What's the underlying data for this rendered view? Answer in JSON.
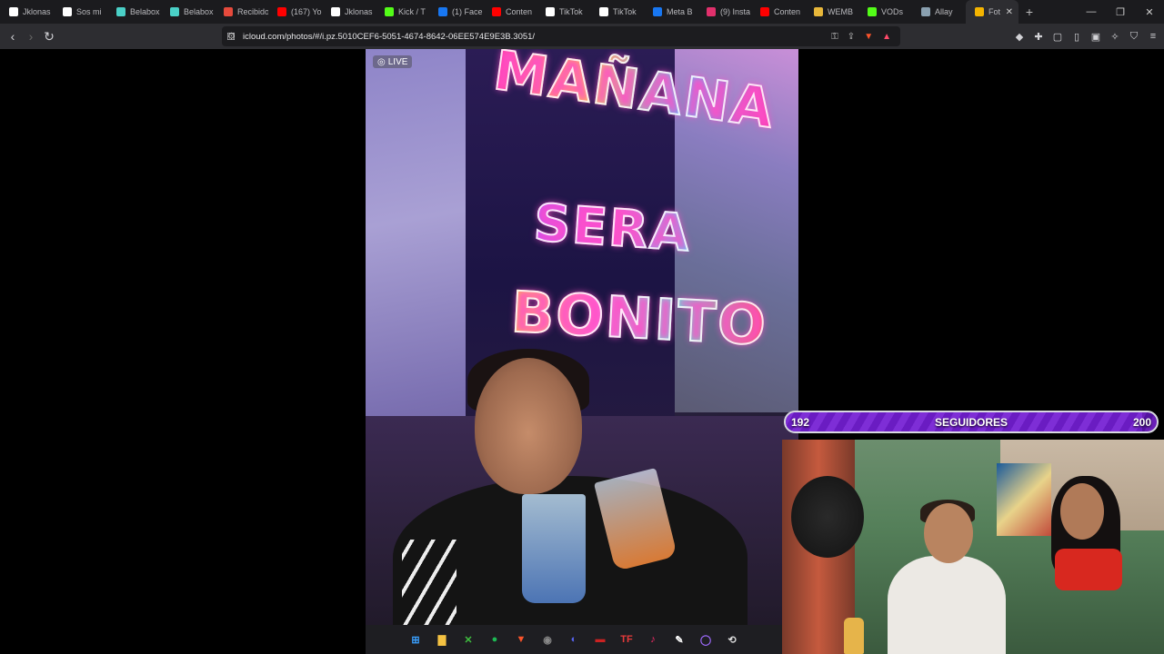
{
  "browser": {
    "tabs": [
      {
        "label": "Jklonas",
        "icon": "github-icon",
        "color": "#ffffff"
      },
      {
        "label": "Sos mi",
        "icon": "github-icon",
        "color": "#ffffff"
      },
      {
        "label": "Belabox",
        "icon": "belabox-icon",
        "color": "#4ad0c7"
      },
      {
        "label": "Belabox",
        "icon": "belabox-icon",
        "color": "#4ad0c7"
      },
      {
        "label": "Recibido",
        "icon": "gmail-icon",
        "color": "#e64a3c"
      },
      {
        "label": "(167) Yo",
        "icon": "youtube-icon",
        "color": "#ff0000"
      },
      {
        "label": "Jklonas",
        "icon": "tiktok-icon",
        "color": "#ffffff"
      },
      {
        "label": "Kick / T",
        "icon": "kick-icon",
        "color": "#53fc18"
      },
      {
        "label": "(1) Face",
        "icon": "facebook-icon",
        "color": "#1877f2"
      },
      {
        "label": "Conten",
        "icon": "youtube-icon",
        "color": "#ff0000"
      },
      {
        "label": "TikTok",
        "icon": "tiktok-icon",
        "color": "#ffffff"
      },
      {
        "label": "TikTok",
        "icon": "tiktok-icon",
        "color": "#ffffff"
      },
      {
        "label": "Meta B",
        "icon": "meta-icon",
        "color": "#1877f2"
      },
      {
        "label": "(9) Insta",
        "icon": "instagram-icon",
        "color": "#e1306c"
      },
      {
        "label": "Conten",
        "icon": "youtube-icon",
        "color": "#ff0000"
      },
      {
        "label": "WEMB",
        "icon": "wemb-icon",
        "color": "#e8b73a"
      },
      {
        "label": "VODs",
        "icon": "kick-icon",
        "color": "#53fc18"
      },
      {
        "label": "Allay",
        "icon": "allay-icon",
        "color": "#8aa0b0"
      },
      {
        "label": "Fot",
        "icon": "photos-icon",
        "color": "#f4b400",
        "active": true
      }
    ],
    "url": "icloud.com/photos/#/i.pz.5010CEF6-5051-4674-8642-06EE574E9E3B.3051/"
  },
  "photo": {
    "live_label": "LIVE",
    "sign_lines": [
      "MAÑANA",
      "SERA",
      "BONITO"
    ]
  },
  "follower_goal": {
    "current": "192",
    "label": "SEGUIDORES",
    "goal": "200",
    "progress": 0.96
  },
  "taskbar": {
    "apps": [
      {
        "name": "windows-start-icon",
        "glyph": "⊞",
        "color": "#3aa0ff"
      },
      {
        "name": "file-explorer-icon",
        "glyph": "▇",
        "color": "#f5c242"
      },
      {
        "name": "xbox-icon",
        "glyph": "✕",
        "color": "#3fbf3f"
      },
      {
        "name": "spotify-icon",
        "glyph": "●",
        "color": "#1db954"
      },
      {
        "name": "brave-icon",
        "glyph": "▼",
        "color": "#fb542b"
      },
      {
        "name": "obs-icon",
        "glyph": "◉",
        "color": "#888888"
      },
      {
        "name": "discord-icon",
        "glyph": "◐",
        "color": "#5865f2"
      },
      {
        "name": "streamlabs-icon",
        "glyph": "▬",
        "color": "#cc2222"
      },
      {
        "name": "tf-icon",
        "glyph": "TF",
        "color": "#e83b3b"
      },
      {
        "name": "tiktok-live-icon",
        "glyph": "♪",
        "color": "#ff2d6b"
      },
      {
        "name": "pen-icon",
        "glyph": "✎",
        "color": "#ffffff"
      },
      {
        "name": "circle-app-icon",
        "glyph": "◯",
        "color": "#9f6bff"
      },
      {
        "name": "back-app-icon",
        "glyph": "⟲",
        "color": "#dddddd"
      }
    ]
  }
}
